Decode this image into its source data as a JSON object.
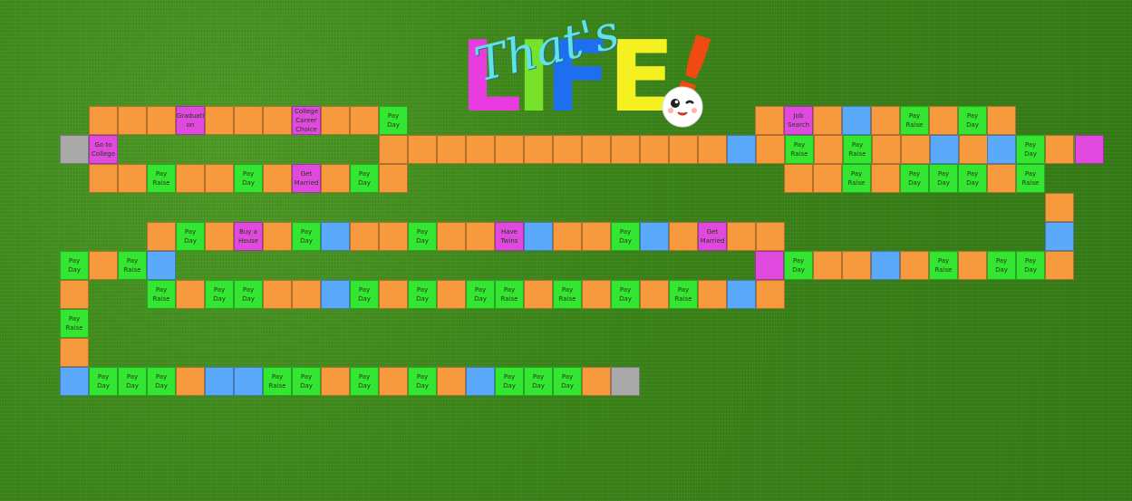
{
  "logo": {
    "title": "LIFE",
    "subtitle": "That's",
    "exclamation": "!",
    "colors": {
      "L": "#e83ce0",
      "I": "#76e22a",
      "F": "#1e6ef2",
      "E": "#f5f020",
      "bang": "#f04a10",
      "script": "#5fe3e8"
    }
  },
  "tile_colors": {
    "orange": "#f79a3e",
    "green": "#34e532",
    "blue": "#5aa9fb",
    "magenta": "#e049de",
    "gray": "#aaaaaa"
  },
  "rows": [
    {
      "tiles": [
        [
          "o",
          ""
        ],
        [
          "o",
          ""
        ],
        [
          "o",
          ""
        ],
        [
          "m",
          "Graduati\non"
        ],
        [
          "o",
          ""
        ],
        [
          "o",
          ""
        ],
        [
          "o",
          ""
        ],
        [
          "m",
          "College\nCareer\nChoice"
        ],
        [
          "o",
          ""
        ],
        [
          "o",
          ""
        ],
        [
          "g",
          "Pay\nDay"
        ]
      ]
    },
    {
      "tiles": [
        [
          "s",
          ""
        ],
        [
          "m",
          "Go to\nCollege"
        ]
      ]
    },
    {
      "tiles": [
        [
          "o",
          ""
        ],
        [
          "o",
          ""
        ],
        [
          "o",
          ""
        ],
        [
          "o",
          ""
        ],
        [
          "o",
          ""
        ],
        [
          "o",
          ""
        ],
        [
          "o",
          ""
        ],
        [
          "o",
          ""
        ],
        [
          "o",
          ""
        ],
        [
          "o",
          ""
        ],
        [
          "o",
          ""
        ],
        [
          "o",
          ""
        ],
        [
          "b",
          ""
        ],
        [
          "o",
          ""
        ],
        [
          "g",
          "Pay\nRaise"
        ],
        [
          "o",
          ""
        ],
        [
          "g",
          "Pay\nRaise"
        ],
        [
          "o",
          ""
        ],
        [
          "o",
          ""
        ],
        [
          "b",
          ""
        ],
        [
          "o",
          ""
        ],
        [
          "g",
          "Pay\nDay"
        ],
        [
          "g",
          "Pay\nDay"
        ],
        [
          "g",
          "Pay\nDay"
        ],
        [
          "m",
          ""
        ]
      ]
    },
    {
      "tiles": [
        [
          "o",
          ""
        ],
        [
          "o",
          ""
        ],
        [
          "g",
          "Pay\nRaise"
        ],
        [
          "o",
          ""
        ],
        [
          "o",
          ""
        ],
        [
          "g",
          "Pay\nDay"
        ],
        [
          "o",
          ""
        ],
        [
          "m",
          "Get\nMarried"
        ],
        [
          "o",
          ""
        ],
        [
          "g",
          "Pay\nDay"
        ],
        [
          "o",
          ""
        ]
      ]
    },
    {
      "tiles": [
        [
          "o",
          ""
        ],
        [
          "m",
          "Job\nSearch"
        ],
        [
          "o",
          ""
        ],
        [
          "b",
          ""
        ],
        [
          "o",
          ""
        ],
        [
          "g",
          "Pay\nRaise"
        ],
        [
          "o",
          ""
        ],
        [
          "g",
          "Pay\nDay"
        ],
        [
          "o",
          ""
        ]
      ]
    },
    {
      "tiles": [
        [
          "b",
          ""
        ],
        [
          "g",
          "Pay\nDay"
        ],
        [
          "o",
          ""
        ]
      ]
    },
    {
      "tiles": [
        [
          "o",
          ""
        ],
        [
          "o",
          ""
        ],
        [
          "g",
          "Pay\nRaise"
        ],
        [
          "o",
          ""
        ],
        [
          "g",
          "Pay\nDay"
        ],
        [
          "g",
          "Pay\nDay"
        ],
        [
          "g",
          "Pay\nDay"
        ],
        [
          "o",
          ""
        ],
        [
          "g",
          "Pay\nRaise"
        ]
      ]
    },
    {
      "tiles": [
        [
          "o",
          ""
        ]
      ]
    },
    {
      "tiles": [
        [
          "o",
          ""
        ],
        [
          "g",
          "Pay\nDay"
        ],
        [
          "o",
          ""
        ],
        [
          "m",
          "Buy a\nHouse"
        ],
        [
          "o",
          ""
        ],
        [
          "g",
          "Pay\nDay"
        ],
        [
          "b",
          ""
        ],
        [
          "o",
          ""
        ],
        [
          "o",
          ""
        ],
        [
          "g",
          "Pay\nDay"
        ],
        [
          "o",
          ""
        ],
        [
          "o",
          ""
        ],
        [
          "m",
          "Have\nTwins"
        ],
        [
          "b",
          ""
        ],
        [
          "o",
          ""
        ],
        [
          "o",
          ""
        ],
        [
          "g",
          "Pay\nDay"
        ],
        [
          "b",
          ""
        ],
        [
          "o",
          ""
        ],
        [
          "m",
          "Get\nMarried"
        ],
        [
          "o",
          ""
        ],
        [
          "o",
          ""
        ]
      ]
    },
    {
      "tiles": [
        [
          "b",
          ""
        ]
      ]
    },
    {
      "tiles": [
        [
          "g",
          "Pay\nDay"
        ],
        [
          "o",
          ""
        ],
        [
          "g",
          "Pay\nRaise"
        ],
        [
          "b",
          ""
        ]
      ]
    },
    {
      "tiles": [
        [
          "m",
          ""
        ],
        [
          "g",
          "Pay\nDay"
        ],
        [
          "o",
          ""
        ],
        [
          "o",
          ""
        ],
        [
          "b",
          ""
        ],
        [
          "o",
          ""
        ],
        [
          "g",
          "Pay\nRaise"
        ],
        [
          "o",
          ""
        ],
        [
          "g",
          "Pay\nDay"
        ],
        [
          "g",
          "Pay\nDay"
        ],
        [
          "o",
          ""
        ]
      ]
    },
    {
      "tiles": [
        [
          "o",
          ""
        ]
      ]
    },
    {
      "tiles": [
        [
          "g",
          "Pay\nRaise"
        ],
        [
          "o",
          ""
        ],
        [
          "g",
          "Pay\nDay"
        ],
        [
          "g",
          "Pay\nDay"
        ],
        [
          "o",
          ""
        ],
        [
          "o",
          ""
        ],
        [
          "b",
          ""
        ],
        [
          "g",
          "Pay\nDay"
        ],
        [
          "o",
          ""
        ],
        [
          "g",
          "Pay\nDay"
        ],
        [
          "o",
          ""
        ],
        [
          "g",
          "Pay\nDay"
        ],
        [
          "g",
          "Pay\nRaise"
        ],
        [
          "o",
          ""
        ],
        [
          "g",
          "Pay\nRaise"
        ],
        [
          "o",
          ""
        ],
        [
          "g",
          "Pay\nDay"
        ],
        [
          "o",
          ""
        ],
        [
          "g",
          "Pay\nRaise"
        ],
        [
          "o",
          ""
        ],
        [
          "b",
          ""
        ],
        [
          "o",
          ""
        ]
      ]
    },
    {
      "tiles": [
        [
          "g",
          "Pay\nRaise"
        ]
      ]
    },
    {
      "tiles": [
        [
          "o",
          ""
        ]
      ]
    },
    {
      "tiles": [
        [
          "b",
          ""
        ],
        [
          "g",
          "Pay\nDay"
        ],
        [
          "g",
          "Pay\nDay"
        ],
        [
          "g",
          "Pay\nDay"
        ],
        [
          "o",
          ""
        ],
        [
          "b",
          ""
        ],
        [
          "b",
          ""
        ],
        [
          "g",
          "Pay\nRaise"
        ],
        [
          "g",
          "Pay\nDay"
        ],
        [
          "o",
          ""
        ],
        [
          "g",
          "Pay\nDay"
        ],
        [
          "o",
          ""
        ],
        [
          "g",
          "Pay\nDay"
        ],
        [
          "o",
          ""
        ],
        [
          "b",
          ""
        ],
        [
          "g",
          "Pay\nDay"
        ],
        [
          "g",
          "Pay\nDay"
        ],
        [
          "g",
          "Pay\nDay"
        ],
        [
          "o",
          ""
        ],
        [
          "s",
          ""
        ]
      ]
    }
  ]
}
